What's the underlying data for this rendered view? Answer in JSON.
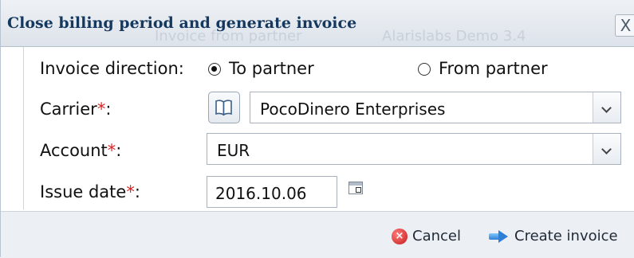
{
  "background_window": {
    "ghost_text_1": "Invoice from partner",
    "ghost_text_2": "Alarislabs Demo 3.4"
  },
  "dialog": {
    "title": "Close billing period and generate invoice",
    "close_label": "X"
  },
  "form": {
    "invoice_direction": {
      "label": "Invoice direction:",
      "options": [
        {
          "label": "To partner",
          "checked": true
        },
        {
          "label": "From partner",
          "checked": false
        }
      ]
    },
    "carrier": {
      "label": "Carrier",
      "required_mark": "*",
      "suffix": ":",
      "value": "PocoDinero Enterprises"
    },
    "account": {
      "label": "Account",
      "required_mark": "*",
      "suffix": ":",
      "value": "EUR"
    },
    "issue_date": {
      "label": "Issue date",
      "required_mark": "*",
      "suffix": ":",
      "value": "2016.10.06"
    }
  },
  "footer": {
    "cancel_label": "Cancel",
    "create_label": "Create invoice"
  },
  "colors": {
    "title_text": "#15385f",
    "required": "#e02020",
    "footer_bg": "#eceff3"
  },
  "icons": {
    "book": "book-icon",
    "calendar": "calendar-icon",
    "cancel": "cancel-icon",
    "create": "arrow-right-icon",
    "close": "close-icon"
  }
}
